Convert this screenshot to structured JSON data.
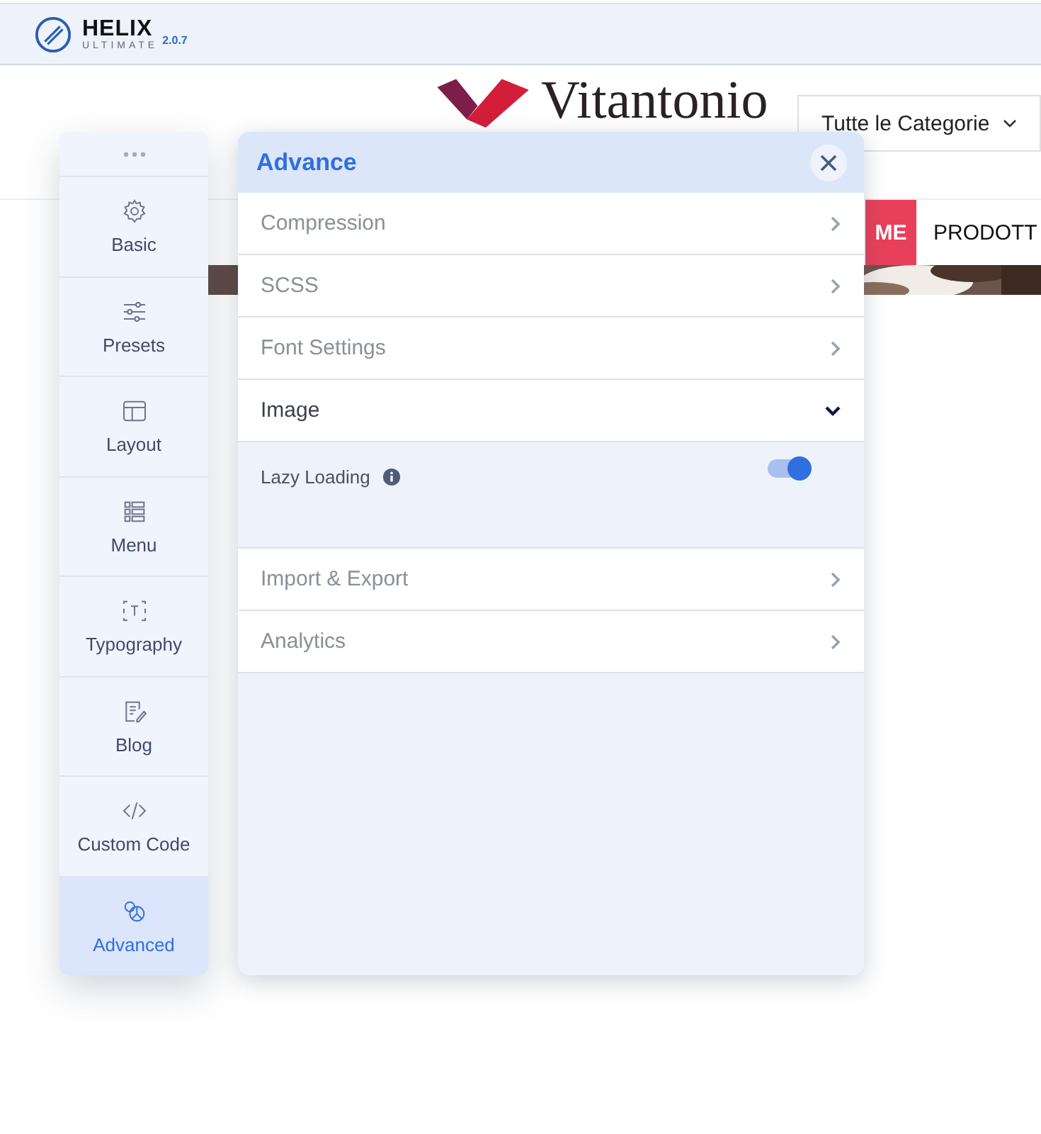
{
  "topbar": {
    "brand": "HELIX",
    "brand_sub": "ULTIMATE",
    "version": "2.0.7"
  },
  "site": {
    "logo_text": "Vitantonio",
    "category_select": "Tutte le Categorie",
    "nav": [
      {
        "label": "ME",
        "selected": true
      },
      {
        "label": "PRODOTT",
        "selected": false
      }
    ]
  },
  "sidebar": {
    "items": [
      {
        "label": "Basic",
        "selected": false
      },
      {
        "label": "Presets",
        "selected": false
      },
      {
        "label": "Layout",
        "selected": false
      },
      {
        "label": "Menu",
        "selected": false
      },
      {
        "label": "Typography",
        "selected": false
      },
      {
        "label": "Blog",
        "selected": false
      },
      {
        "label": "Custom Code",
        "selected": false
      },
      {
        "label": "Advanced",
        "selected": true
      }
    ]
  },
  "panel": {
    "title": "Advance",
    "sections": [
      {
        "label": "Compression",
        "expanded": false
      },
      {
        "label": "SCSS",
        "expanded": false
      },
      {
        "label": "Font Settings",
        "expanded": false
      },
      {
        "label": "Image",
        "expanded": true,
        "settings": [
          {
            "kind": "toggle",
            "label": "Lazy Loading",
            "on": true
          }
        ]
      },
      {
        "label": "Import & Export",
        "expanded": false
      },
      {
        "label": "Analytics",
        "expanded": false
      }
    ]
  }
}
